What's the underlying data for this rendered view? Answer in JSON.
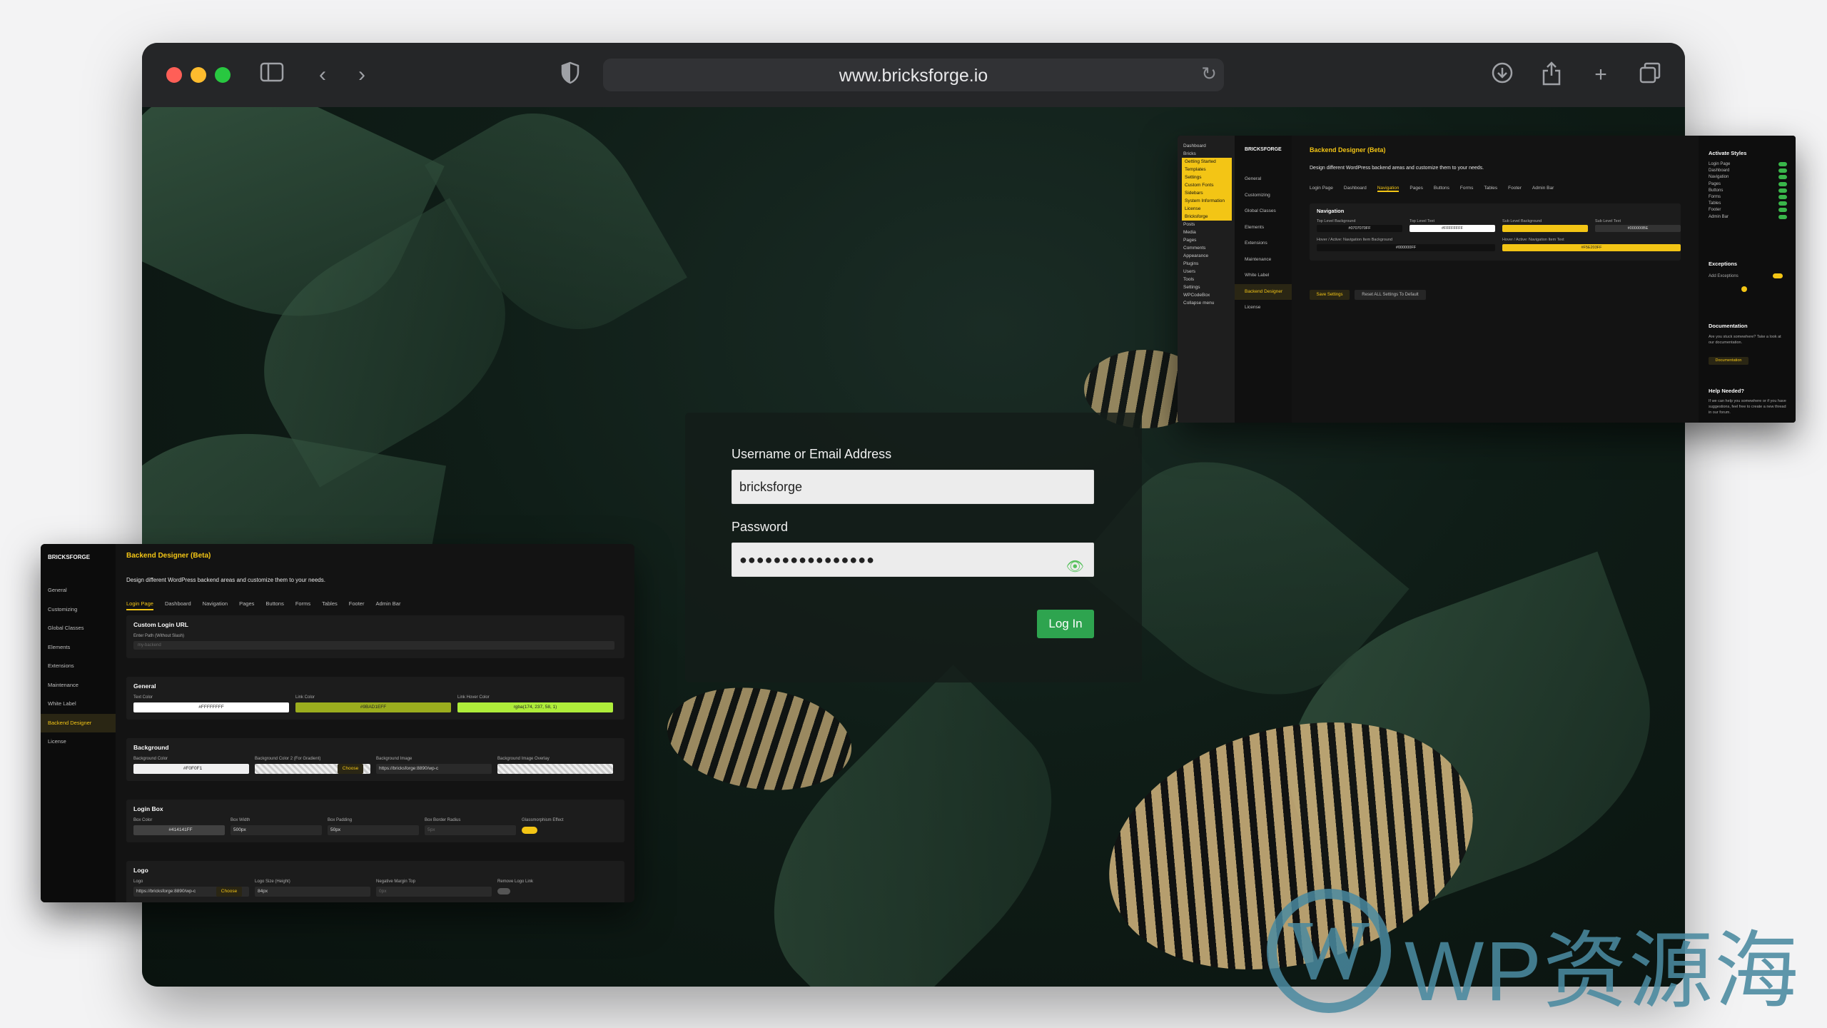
{
  "browser": {
    "url": "www.bricksforge.io"
  },
  "login": {
    "username_label": "Username or Email Address",
    "username_value": "bricksforge",
    "password_label": "Password",
    "password_value": "●●●●●●●●●●●●●●●●",
    "login_button": "Log In"
  },
  "left_panel": {
    "logo": "BRICKSFORGE",
    "sidebar": [
      "General",
      "Customizing",
      "Global Classes",
      "Elements",
      "Extensions",
      "Maintenance",
      "White Label",
      "Backend Designer",
      "License"
    ],
    "title": "Backend Designer (Beta)",
    "description": "Design different WordPress backend areas and customize them to your needs.",
    "tabs": [
      "Login Page",
      "Dashboard",
      "Navigation",
      "Pages",
      "Buttons",
      "Forms",
      "Tables",
      "Footer",
      "Admin Bar"
    ],
    "custom_login": {
      "title": "Custom Login URL",
      "field_label": "Enter Path (Without Slash)",
      "placeholder": "my-backend"
    },
    "general": {
      "title": "General",
      "fields": [
        {
          "label": "Text Color",
          "value": "#FFFFFFFF"
        },
        {
          "label": "Link Color",
          "value": "#9BAD1EFF"
        },
        {
          "label": "Link Hover Color",
          "value": "rgba(174, 237, 58, 1)"
        }
      ]
    },
    "background": {
      "title": "Background",
      "fields": [
        {
          "label": "Background Color",
          "value": "#F0F0F1"
        },
        {
          "label": "Background Color 2 (For Gradient)",
          "value": ""
        },
        {
          "label": "Background Image",
          "value": "https://bricksforge:8890/wp-c"
        },
        {
          "label": "Background Image Overlay",
          "value": ""
        }
      ],
      "choose": "Choose"
    },
    "login_box": {
      "title": "Login Box",
      "fields": [
        {
          "label": "Box Color",
          "value": "#414141FF"
        },
        {
          "label": "Box Width",
          "value": "500px"
        },
        {
          "label": "Box Padding",
          "value": "50px"
        },
        {
          "label": "Box Border Radius",
          "value": "5px"
        },
        {
          "label": "Glassmorphism Effect",
          "value": ""
        }
      ]
    },
    "logo_sec": {
      "title": "Logo",
      "fields": [
        {
          "label": "Logo",
          "value": "https://bricksforge:8890/wp-c"
        },
        {
          "label": "Logo Size (Height)",
          "value": "84px"
        },
        {
          "label": "Negative Margin Top",
          "value": "0px"
        },
        {
          "label": "Remove Logo Link",
          "value": ""
        }
      ],
      "choose": "Choose"
    }
  },
  "right_panel": {
    "wp_menu": [
      "Dashboard",
      "Bricks",
      "Getting Started",
      "Templates",
      "Settings",
      "Custom Fonts",
      "Sidebars",
      "System Information",
      "License",
      "Bricksforge",
      "Posts",
      "Media",
      "Pages",
      "Comments",
      "Appearance",
      "Plugins",
      "Users",
      "Tools",
      "Settings",
      "WPCodeBox",
      "Collapse menu"
    ],
    "logo": "BRICKSFORGE",
    "sidebar": [
      "General",
      "Customizing",
      "Global Classes",
      "Elements",
      "Extensions",
      "Maintenance",
      "White Label",
      "Backend Designer",
      "License"
    ],
    "title": "Backend Designer (Beta)",
    "description": "Design different WordPress backend areas and customize them to your needs.",
    "tabs": [
      "Login Page",
      "Dashboard",
      "Navigation",
      "Pages",
      "Buttons",
      "Forms",
      "Tables",
      "Footer",
      "Admin Bar"
    ],
    "nav_section": {
      "title": "Navigation",
      "row1": [
        {
          "label": "Top Level Background",
          "value": "#0707070FF"
        },
        {
          "label": "Top Level Text",
          "value": "#FFFFFFFF"
        },
        {
          "label": "Sub Level Background",
          "value": ""
        },
        {
          "label": "Sub Level Text",
          "value": "#000000BE"
        }
      ],
      "row2": [
        {
          "label": "Hover / Active: Navigation Item Background",
          "value": "#000000FF"
        },
        {
          "label": "Hover / Active: Navigation Item Text",
          "value": "#F5E203FF"
        }
      ]
    },
    "save_button": "Save Settings",
    "reset_button": "Reset ALL Settings To Default",
    "activate": {
      "title": "Activate Styles",
      "items": [
        "Login Page",
        "Dashboard",
        "Navigation",
        "Pages",
        "Buttons",
        "Forms",
        "Tables",
        "Footer",
        "Admin Bar"
      ]
    },
    "exceptions": {
      "title": "Exceptions",
      "label": "Add Exceptions"
    },
    "documentation": {
      "title": "Documentation",
      "text": "Are you stuck somewhere? Take a look at our documentation.",
      "button": "Documentation"
    },
    "help": {
      "title": "Help Needed?",
      "text": "If we can help you somewhere or if you have suggestions, feel free to create a new thread in our forum."
    }
  },
  "watermark": {
    "text": "WP资源海"
  },
  "colors": {
    "accent": "#F3C515",
    "green": "#2EA44F",
    "link_green": "#9BAD1E",
    "hover_green": "#AEED3A"
  }
}
